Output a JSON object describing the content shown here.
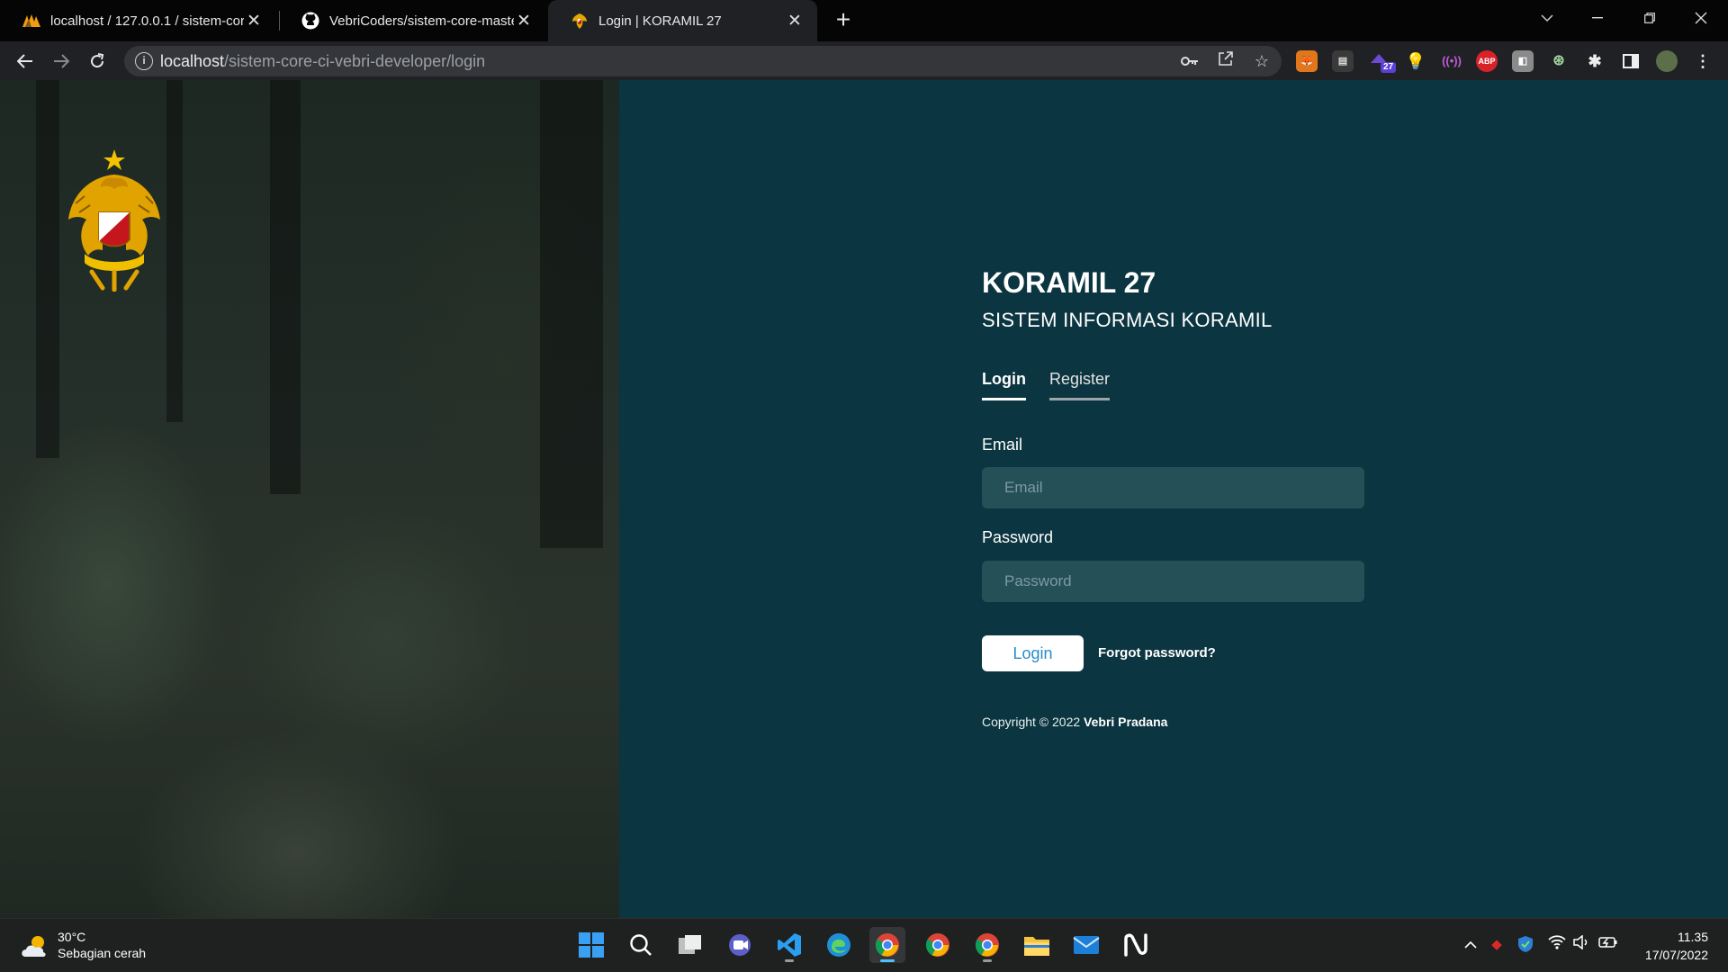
{
  "browser": {
    "tabs": [
      {
        "title": "localhost / 127.0.0.1 / sistem-core",
        "icon": "phpmyadmin-icon"
      },
      {
        "title": "VebriCoders/sistem-core-master-",
        "icon": "github-icon"
      },
      {
        "title": "Login | KORAMIL 27",
        "icon": "koramil-emblem-icon",
        "active": true
      }
    ],
    "url_host": "localhost",
    "url_path": "/sistem-core-ci-vebri-developer/login",
    "extension_badge": "27",
    "abp_label": "ABP"
  },
  "page": {
    "brand_title": "KORAMIL 27",
    "brand_subtitle": "SISTEM INFORMASI KORAMIL",
    "tabs": {
      "login": "Login",
      "register": "Register"
    },
    "email_label": "Email",
    "email_placeholder": "Email",
    "password_label": "Password",
    "password_placeholder": "Password",
    "login_button": "Login",
    "forgot_link": "Forgot password?",
    "copyright_prefix": "Copyright © 2022",
    "copyright_author": "Vebri Pradana",
    "colors": {
      "panel_bg": "#0b3540",
      "field_bg": "#255058",
      "button_text": "#2a8cc9"
    }
  },
  "taskbar": {
    "temperature": "30°C",
    "weather": "Sebagian cerah",
    "time": "11.35",
    "date": "17/07/2022"
  }
}
